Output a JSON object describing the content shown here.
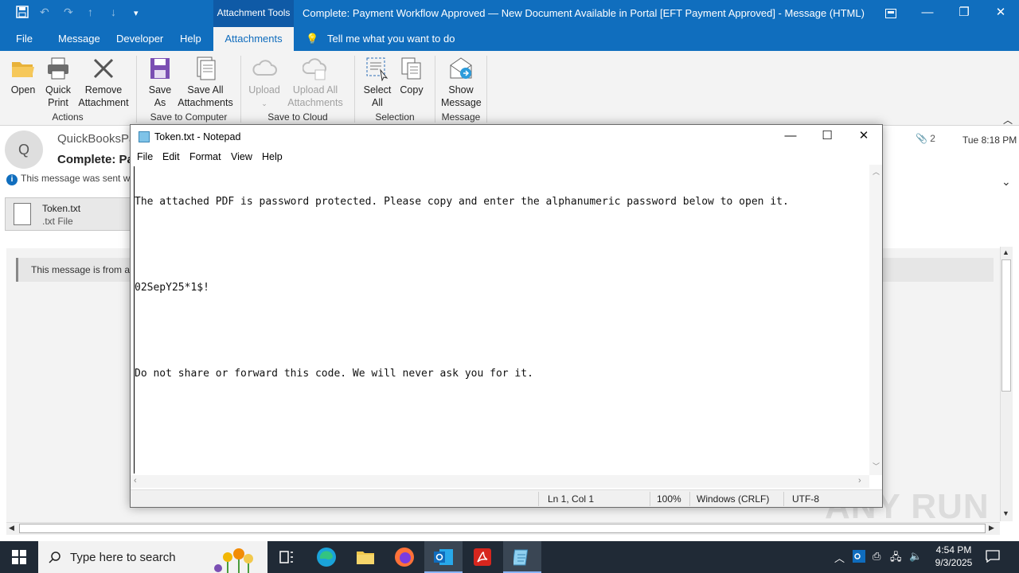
{
  "outlook": {
    "title_bar": {
      "context_tab": "Attachment Tools",
      "window_title": "Complete: Payment Workflow Approved — New Document Available in Portal [EFT Payment Approved]  -  Message (HTML)"
    },
    "menu_tabs": [
      "File",
      "Message",
      "Developer",
      "Help",
      "Attachments"
    ],
    "tell_me": "Tell me what you want to do",
    "ribbon": {
      "actions": {
        "open": "Open",
        "quick_print": "Quick Print",
        "remove_attachment": "Remove Attachment",
        "group": "Actions"
      },
      "save_to_computer": {
        "save_as": "Save As",
        "save_all": "Save All Attachments",
        "group": "Save to Computer"
      },
      "save_to_cloud": {
        "upload": "Upload",
        "upload_all": "Upload All Attachments",
        "group": "Save to Cloud"
      },
      "selection": {
        "select_all": "Select All",
        "copy": "Copy",
        "group": "Selection"
      },
      "message": {
        "show_message": "Show Message",
        "group": "Message"
      }
    },
    "message": {
      "avatar_letter": "Q",
      "sender": "QuickBooksPa",
      "subject": "Complete: Pa",
      "info": "This message was sent wit",
      "attachment_count": "2",
      "time": "Tue 8:18 PM",
      "attachment": {
        "name": "Token.txt",
        "type": ".txt File"
      },
      "banner": "This message is from a"
    }
  },
  "notepad": {
    "title": "Token.txt - Notepad",
    "menu": [
      "File",
      "Edit",
      "Format",
      "View",
      "Help"
    ],
    "lines": [
      "The attached PDF is password protected. Please copy and enter the alphanumeric password below to open it.",
      "",
      "02SepY25*1$!",
      "",
      "Do not share or forward this code. We will never ask you for it."
    ],
    "status": {
      "position": "Ln 1, Col 1",
      "zoom": "100%",
      "line_endings": "Windows (CRLF)",
      "encoding": "UTF-8"
    }
  },
  "taskbar": {
    "search_placeholder": "Type here to search",
    "time": "4:54 PM",
    "date": "9/3/2025"
  },
  "watermark": "ANY RUN"
}
